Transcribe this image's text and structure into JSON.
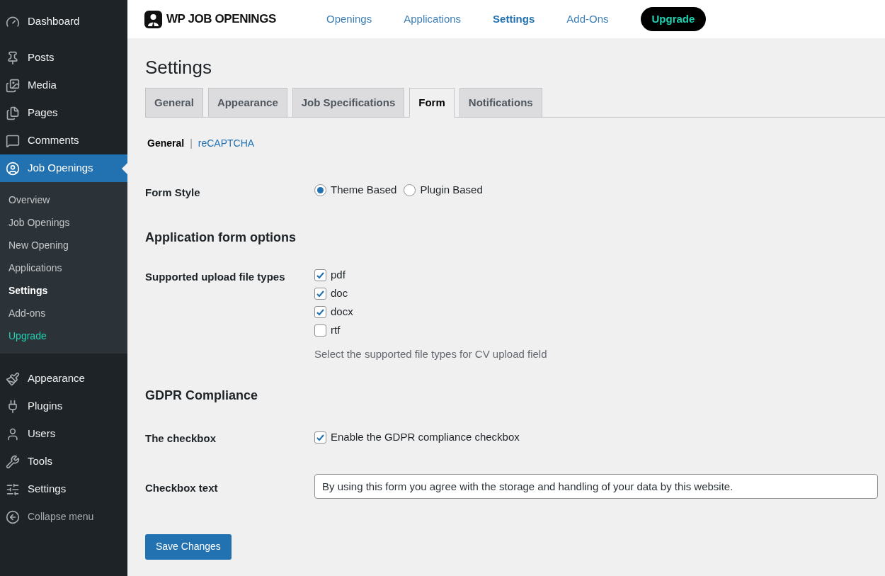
{
  "sidebar": {
    "items": [
      {
        "label": "Dashboard",
        "selected": false
      },
      {
        "label": "Posts",
        "selected": false
      },
      {
        "label": "Media",
        "selected": false
      },
      {
        "label": "Pages",
        "selected": false
      },
      {
        "label": "Comments",
        "selected": false
      },
      {
        "label": "Job Openings",
        "selected": true,
        "submenu": [
          {
            "label": "Overview",
            "selected": false,
            "kind": "link"
          },
          {
            "label": "Job Openings",
            "selected": false,
            "kind": "link"
          },
          {
            "label": "New Opening",
            "selected": false,
            "kind": "link"
          },
          {
            "label": "Applications",
            "selected": false,
            "kind": "link"
          },
          {
            "label": "Settings",
            "selected": true,
            "kind": "link"
          },
          {
            "label": "Add-ons",
            "selected": false,
            "kind": "link"
          },
          {
            "label": "Upgrade",
            "selected": false,
            "kind": "upgrade"
          }
        ]
      },
      {
        "label": "Appearance",
        "selected": false
      },
      {
        "label": "Plugins",
        "selected": false
      },
      {
        "label": "Users",
        "selected": false
      },
      {
        "label": "Tools",
        "selected": false
      },
      {
        "label": "Settings",
        "selected": false
      }
    ],
    "collapse": "Collapse menu"
  },
  "header": {
    "logo": "WP JOB OPENINGS",
    "nav": [
      {
        "label": "Openings",
        "selected": false
      },
      {
        "label": "Applications",
        "selected": false
      },
      {
        "label": "Settings",
        "selected": true
      },
      {
        "label": "Add-Ons",
        "selected": false
      }
    ],
    "upgrade": "Upgrade"
  },
  "page": {
    "title": "Settings",
    "tabs": [
      {
        "label": "General",
        "selected": false
      },
      {
        "label": "Appearance",
        "selected": false
      },
      {
        "label": "Job Specifications",
        "selected": false
      },
      {
        "label": "Form",
        "selected": true
      },
      {
        "label": "Notifications",
        "selected": false
      }
    ],
    "subnav": [
      {
        "label": "General",
        "selected": true
      },
      {
        "label": "reCAPTCHA",
        "selected": false
      }
    ],
    "subnav_separator": "|",
    "rows": [
      {
        "kind": "radio",
        "label": "Form Style",
        "options": [
          {
            "label": "Theme Based",
            "selected": true
          },
          {
            "label": "Plugin Based",
            "selected": false
          }
        ]
      },
      {
        "kind": "heading",
        "label": "Application form options"
      },
      {
        "kind": "checkboxes",
        "label": "Supported upload file types",
        "options": [
          {
            "label": "pdf",
            "checked": true
          },
          {
            "label": "doc",
            "checked": true
          },
          {
            "label": "docx",
            "checked": true
          },
          {
            "label": "rtf",
            "checked": false
          }
        ],
        "description": "Select the supported file types for CV upload field"
      },
      {
        "kind": "heading",
        "label": "GDPR Compliance"
      },
      {
        "kind": "checkboxes",
        "label": "The checkbox",
        "options": [
          {
            "label": "Enable the GDPR compliance checkbox",
            "checked": true
          }
        ]
      },
      {
        "kind": "text",
        "label": "Checkbox text",
        "value": "By using this form you agree with the storage and handling of your data by this website."
      }
    ],
    "save_button": "Save Changes"
  }
}
